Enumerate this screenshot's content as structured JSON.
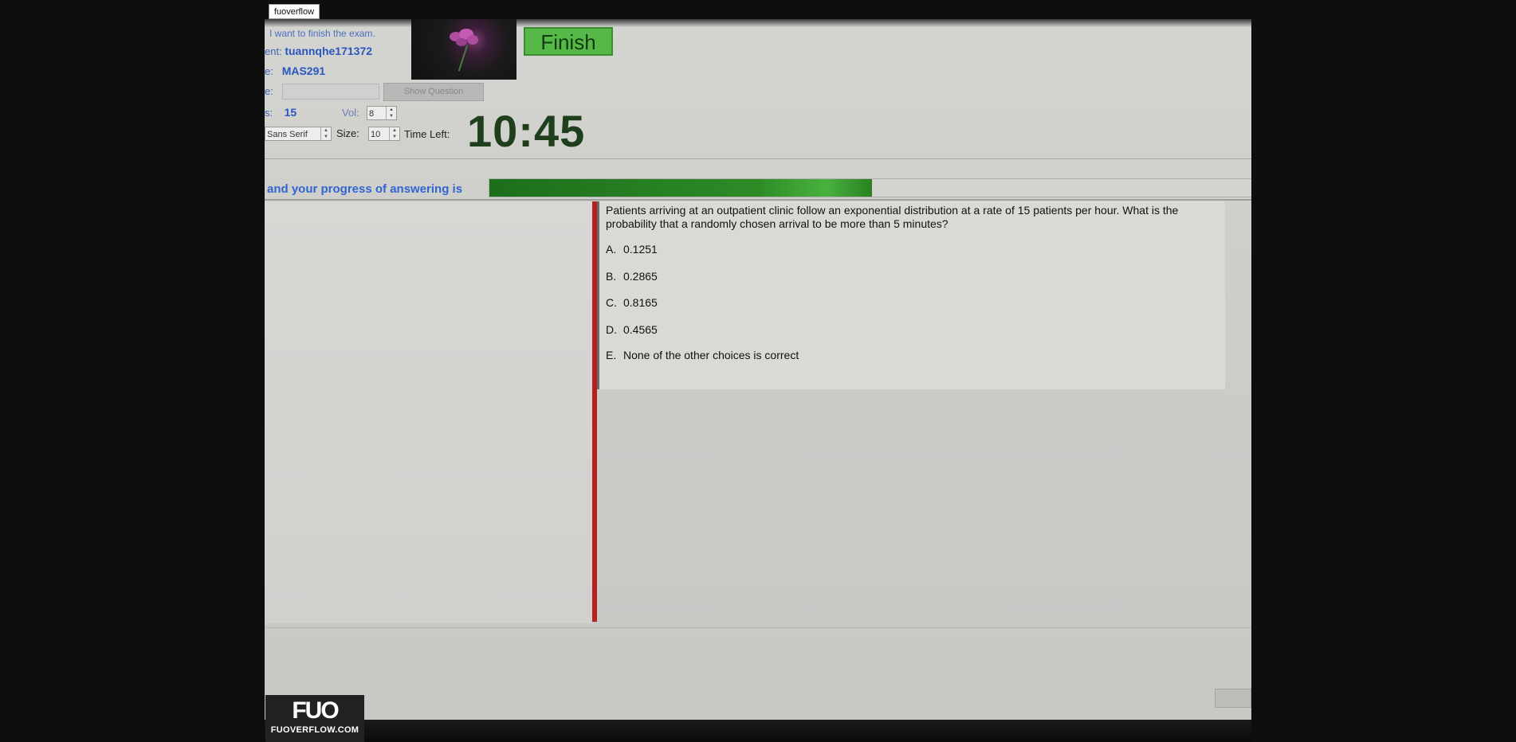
{
  "site_tag": "fuoverflow",
  "header": {
    "finish_message": "I want to finish the exam.",
    "student_label": "ent:",
    "student_id": "tuannqhe171372",
    "course_label": "e:",
    "course_code": "MAS291",
    "code_label": "e:",
    "code_value": "",
    "show_question_label": "Show Question",
    "questions_label": "s:",
    "questions_count": "15",
    "vol_label": "Vol:",
    "vol_value": "8",
    "font_value": "Sans Serif",
    "size_label": "Size:",
    "size_value": "10",
    "time_left_label": "Time Left:",
    "timer": "10:45",
    "finish_button": "Finish",
    "photo_icon": "flower-photo-icon"
  },
  "progress": {
    "label": "and your progress of answering is",
    "fraction": 0.5,
    "color": "#2d8b26"
  },
  "question": {
    "text": "Patients arriving at an outpatient clinic follow an exponential distribution at a rate of 15 patients per hour. What is the probability that a randomly chosen arrival to be more than 5 minutes?",
    "options": [
      {
        "letter": "A.",
        "text": "0.1251"
      },
      {
        "letter": "B.",
        "text": "0.2865"
      },
      {
        "letter": "C.",
        "text": "0.8165"
      },
      {
        "letter": "D.",
        "text": "0.4565"
      },
      {
        "letter": "E.",
        "text": "None of the other choices is correct"
      }
    ]
  },
  "watermark": {
    "logo_mark": "FUO",
    "logo_url": "FUOVERFLOW.COM"
  },
  "colors": {
    "accent_blue": "#3165d0",
    "finish_green": "#56b947",
    "divider_red": "#b3221e"
  }
}
